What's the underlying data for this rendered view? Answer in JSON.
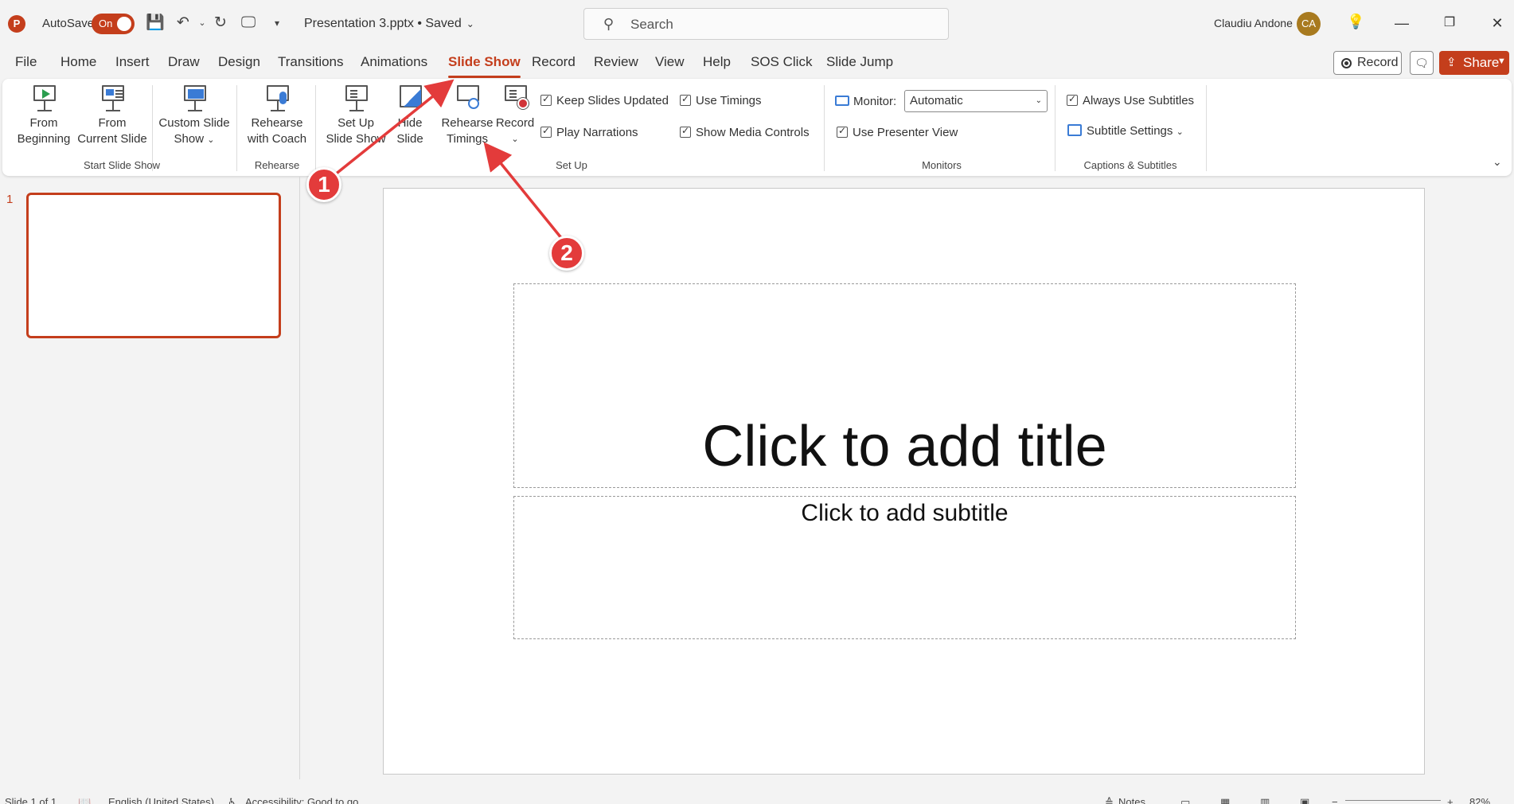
{
  "titlebar": {
    "app_icon_letter": "P",
    "autosave_label": "AutoSave",
    "autosave_state": "On",
    "document_title": "Presentation 3.pptx • Saved",
    "search_placeholder": "Search",
    "user_name": "Claudiu Andone",
    "user_initials": "CA",
    "accent_color": "#c43e1c"
  },
  "tabs": [
    {
      "label": "File"
    },
    {
      "label": "Home"
    },
    {
      "label": "Insert"
    },
    {
      "label": "Draw"
    },
    {
      "label": "Design"
    },
    {
      "label": "Transitions"
    },
    {
      "label": "Animations"
    },
    {
      "label": "Slide Show",
      "active": true
    },
    {
      "label": "Record"
    },
    {
      "label": "Review"
    },
    {
      "label": "View"
    },
    {
      "label": "Help"
    },
    {
      "label": "SOS Click"
    },
    {
      "label": "Slide Jump"
    }
  ],
  "top_actions": {
    "record_label": "Record",
    "share_label": "Share"
  },
  "ribbon": {
    "start": {
      "from_beginning_1": "From",
      "from_beginning_2": "Beginning",
      "from_current_1": "From",
      "from_current_2": "Current Slide",
      "custom_1": "Custom Slide",
      "custom_2": "Show",
      "group": "Start Slide Show"
    },
    "rehearse": {
      "coach_1": "Rehearse",
      "coach_2": "with Coach",
      "group": "Rehearse"
    },
    "setup": {
      "setup_1": "Set Up",
      "setup_2": "Slide Show",
      "hide_1": "Hide",
      "hide_2": "Slide",
      "timings_1": "Rehearse",
      "timings_2": "Timings",
      "record": "Record",
      "keep_updated": "Keep Slides Updated",
      "play_narrations": "Play Narrations",
      "use_timings": "Use Timings",
      "show_media": "Show Media Controls",
      "group": "Set Up"
    },
    "monitors": {
      "monitor_label": "Monitor:",
      "monitor_value": "Automatic",
      "presenter_view": "Use Presenter View",
      "group": "Monitors"
    },
    "captions": {
      "always_subtitles": "Always Use Subtitles",
      "subtitle_settings": "Subtitle Settings",
      "group": "Captions & Subtitles"
    }
  },
  "slides_pane": {
    "thumb_number": "1"
  },
  "slide": {
    "title_placeholder": "Click to add title",
    "subtitle_placeholder": "Click to add subtitle"
  },
  "annotations": {
    "badge_1": "1",
    "badge_2": "2",
    "color": "#e33b3b"
  },
  "status": {
    "slide_count": "Slide 1 of 1",
    "language": "English (United States)",
    "accessibility": "Accessibility: Good to go",
    "notes": "Notes",
    "zoom": "82%"
  }
}
